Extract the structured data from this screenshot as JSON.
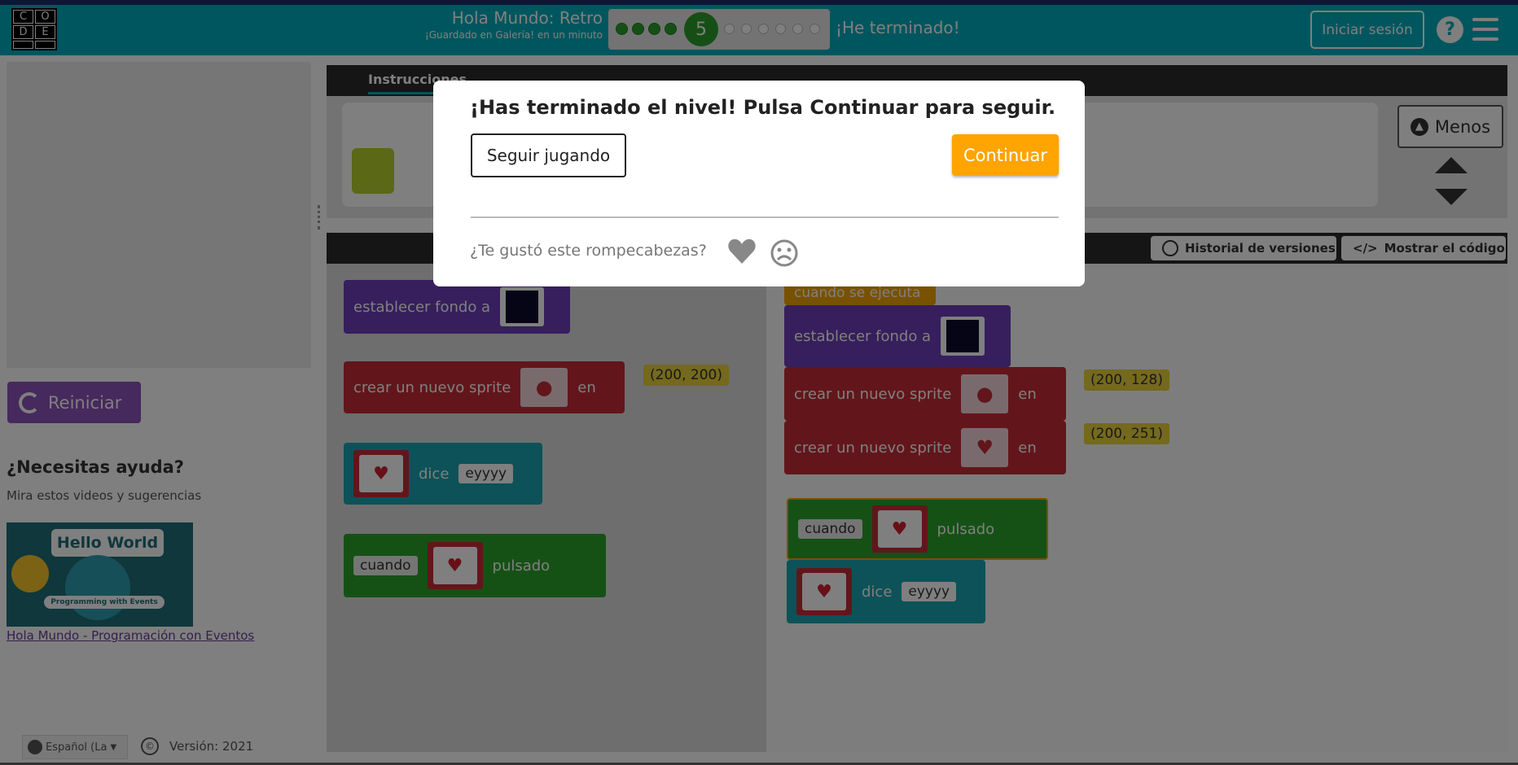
{
  "header": {
    "logo_letters": [
      "C",
      "O",
      "D",
      "E",
      "",
      ""
    ],
    "title": "Hola Mundo: Retro",
    "saved_note": "¡Guardado en Galería! en un minuto",
    "progress": {
      "completed": 4,
      "current": "5",
      "remaining": 6
    },
    "finished_label": "¡He terminado!",
    "signin_label": "Iniciar sesión",
    "help_glyph": "?"
  },
  "left_panel": {
    "reset_label": "Reiniciar",
    "help_heading": "¿Necesitas ayuda?",
    "help_sub": "Mira estos videos y sugerencias",
    "video_title": "Hello World",
    "video_subtitle": "Programming with Events",
    "video_link": "Hola Mundo - Programación con Eventos"
  },
  "instructions": {
    "tab_label": "Instrucciones",
    "less_label": "Menos"
  },
  "workspace_bar": {
    "history_label": "Historial de versiones",
    "show_code_label": "Mostrar el código"
  },
  "toolbox": {
    "set_background": "establecer fondo a",
    "create_sprite": "crear un nuevo sprite",
    "at": "en",
    "coord": "(200, 200)",
    "says": "dice",
    "says_value": "eyyyy",
    "when": "cuando",
    "pressed": "pulsado"
  },
  "workspace": {
    "when_run": "cuando se ejecuta",
    "set_background": "establecer fondo a",
    "create_sprite": "crear un nuevo sprite",
    "at": "en",
    "coord_1": "(200, 128)",
    "coord_2": "(200, 251)",
    "when": "cuando",
    "pressed": "pulsado",
    "says": "dice",
    "says_value": "eyyyy"
  },
  "modal": {
    "title": "¡Has terminado el nivel! Pulsa Continuar para seguir.",
    "keep_playing": "Seguir jugando",
    "continue": "Continuar",
    "feedback_question": "¿Te gustó este rompecabezas?"
  },
  "footer": {
    "language": "Español (La",
    "copyright_glyph": "©",
    "version": "Versión: 2021"
  },
  "colors": {
    "header": "#00adbc",
    "continue": "#ffa400",
    "reset": "#8c52ba"
  }
}
